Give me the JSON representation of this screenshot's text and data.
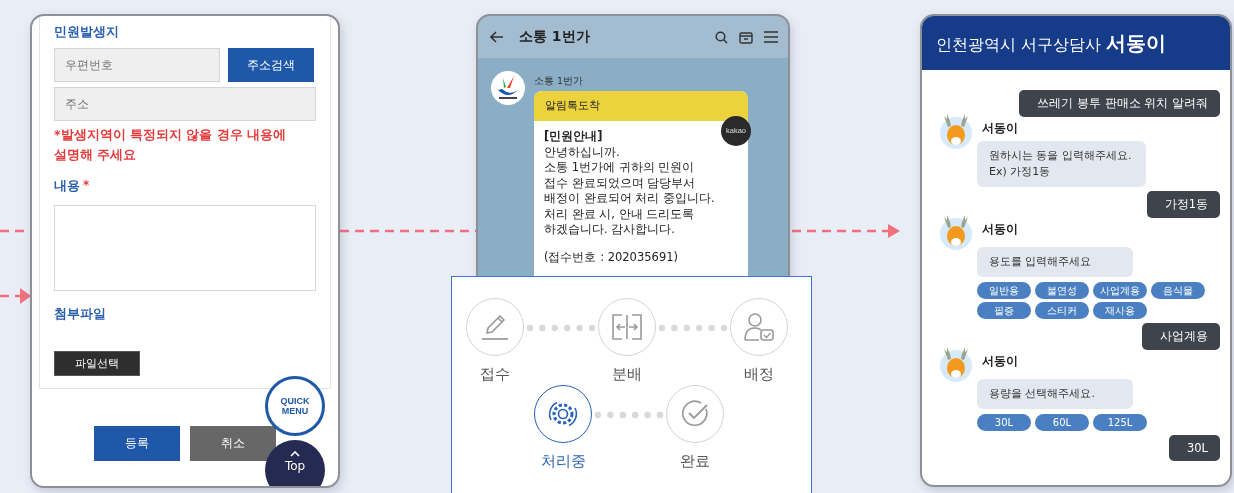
{
  "form": {
    "location_label": "민원발생지",
    "postcode_placeholder": "우편번호",
    "search_button": "주소검색",
    "address_placeholder": "주소",
    "notice": "*발생지역이 특정되지 않을 경우 내용에 설명해 주세요",
    "content_label": "내용",
    "required_mark": "*",
    "attachment_label": "첨부파일",
    "file_button": "파일선택",
    "submit_button": "등록",
    "cancel_button": "취소",
    "quick_menu": "QUICK MENU",
    "top_button": "Top"
  },
  "kakao": {
    "chat_title": "소통 1번가",
    "sender": "소통 1번가",
    "badge": "kakao",
    "card_header": "알림톡도착",
    "heading": "[민원안내]",
    "lines": [
      "안녕하십니까.",
      "소통 1번가에 귀하의 민원이",
      "접수 완료되었으며 담당부서",
      "배정이 완료되어 처리 중입니다.",
      "처리 완료 시, 안내 드리도록",
      "하겠습니다. 감사합니다."
    ],
    "receipt": "(접수번호 : 202035691)"
  },
  "process": {
    "rows": [
      [
        {
          "label": "접수",
          "kind": "pencil",
          "active": false
        },
        {
          "label": "분배",
          "kind": "split",
          "active": false
        },
        {
          "label": "배정",
          "kind": "assign",
          "active": false
        }
      ],
      [
        {
          "label": "처리중",
          "kind": "gear",
          "active": true
        },
        {
          "label": "완료",
          "kind": "check",
          "active": false
        }
      ]
    ]
  },
  "chatbot": {
    "title": "인천광역시 서구상담사 **서동이**",
    "messages": [
      {
        "kind": "user",
        "text": "쓰레기 봉투 판매소 위치 알려줘"
      },
      {
        "kind": "bot",
        "name": "서동이",
        "lines": [
          "원하시는 동을 입력해주세요.",
          "Ex) 가정1동"
        ]
      },
      {
        "kind": "user",
        "text": "가정1동"
      },
      {
        "kind": "bot",
        "name": "서동이",
        "lines": [
          "용도를 입력해주세요"
        ],
        "options": [
          "일반용",
          "불연성",
          "사업계용",
          "음식물",
          "필증",
          "스티커",
          "재사용"
        ]
      },
      {
        "kind": "user",
        "text": "사업계용"
      },
      {
        "kind": "bot",
        "name": "서동이",
        "lines": [
          "용량을 선택해주세요."
        ],
        "options": [
          "30L",
          "60L",
          "125L"
        ]
      },
      {
        "kind": "user",
        "text": "30L"
      }
    ]
  }
}
